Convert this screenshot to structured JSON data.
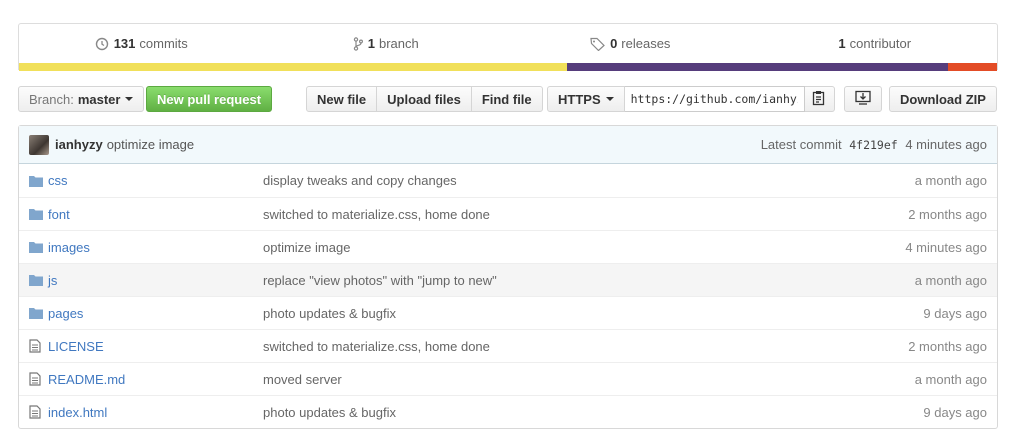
{
  "stats": [
    {
      "num": "131",
      "label": "commits",
      "icon": "history-icon"
    },
    {
      "num": "1",
      "label": "branch",
      "icon": "branch-icon"
    },
    {
      "num": "0",
      "label": "releases",
      "icon": "tag-icon"
    },
    {
      "num": "1",
      "label": "contributor",
      "icon": "people-icon"
    }
  ],
  "languages": [
    {
      "color": "#f1e05a",
      "percent": 56
    },
    {
      "color": "#563d7c",
      "percent": 39
    },
    {
      "color": "#e34c26",
      "percent": 5
    }
  ],
  "toolbar": {
    "branch_label": "Branch:",
    "branch_value": "master",
    "new_pr": "New pull request",
    "new_file": "New file",
    "upload_files": "Upload files",
    "find_file": "Find file",
    "protocol": "HTTPS",
    "clone_url": "https://github.com/ianhyzy",
    "download_zip": "Download ZIP"
  },
  "latest_commit": {
    "author": "ianhyzy",
    "message": "optimize image",
    "prefix": "Latest commit",
    "sha": "4f219ef",
    "age": "4 minutes ago"
  },
  "files": [
    {
      "type": "dir",
      "name": "css",
      "message": "display tweaks and copy changes",
      "age": "a month ago"
    },
    {
      "type": "dir",
      "name": "font",
      "message": "switched to materialize.css, home done",
      "age": "2 months ago"
    },
    {
      "type": "dir",
      "name": "images",
      "message": "optimize image",
      "age": "4 minutes ago"
    },
    {
      "type": "dir",
      "name": "js",
      "message": "replace \"view photos\" with \"jump to new\"",
      "age": "a month ago"
    },
    {
      "type": "dir",
      "name": "pages",
      "message": "photo updates & bugfix",
      "age": "9 days ago"
    },
    {
      "type": "file",
      "name": "LICENSE",
      "message": "switched to materialize.css, home done",
      "age": "2 months ago"
    },
    {
      "type": "file",
      "name": "README.md",
      "message": "moved server",
      "age": "a month ago"
    },
    {
      "type": "file",
      "name": "index.html",
      "message": "photo updates & bugfix",
      "age": "9 days ago"
    }
  ]
}
